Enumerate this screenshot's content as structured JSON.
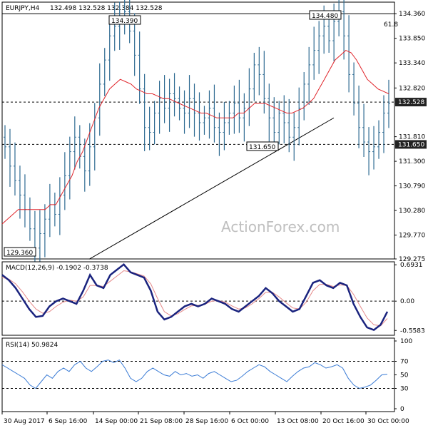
{
  "colors": {
    "price_bars": "#2f6b92",
    "ma_line": "#e0242a",
    "macd_line": "#1a237e",
    "signal_line": "#e58a8a",
    "rsi_line": "#3a7bd5",
    "hline": "#000000",
    "frame": "#000000"
  },
  "watermark": "ActionForex.com",
  "chart_data": [
    {
      "type": "ohlc",
      "title": "EURJPY,H4",
      "ohlc_header": "132.498 132.528 132.384 132.528",
      "ylim": [
        129.275,
        134.6
      ],
      "y_ticks": [
        "134.360",
        "133.850",
        "133.340",
        "132.820",
        "132.528",
        "131.810",
        "131.650",
        "131.300",
        "130.790",
        "130.280",
        "129.770",
        "129.275"
      ],
      "x_ticks": [
        "30 Aug 2017",
        "6 Sep 16:00",
        "14 Sep 00:00",
        "21 Sep 08:00",
        "28 Sep 16:00",
        "6 Oct 00:00",
        "13 Oct 08:00",
        "20 Oct 16:00",
        "30 Oct 00:00"
      ],
      "current_price": "132.528",
      "annotations": [
        {
          "label": "134.390",
          "value": 134.39
        },
        {
          "label": "134.480",
          "value": 134.48
        },
        {
          "label": "131.650",
          "value": 131.65
        },
        {
          "label": "129.360",
          "value": 129.36
        },
        {
          "label": "61.8",
          "value": 134.36
        }
      ],
      "horizontal_levels": [
        134.36,
        132.528,
        131.65
      ],
      "trendline": {
        "from": {
          "x": "6 Sep 16:00",
          "y": 129.2
        },
        "to": {
          "x": "20 Oct 16:00",
          "y": 132.2
        }
      },
      "series": [
        {
          "name": "close",
          "values": [
            131.6,
            131.2,
            130.9,
            130.6,
            130.3,
            129.9,
            129.5,
            129.8,
            130.1,
            130.4,
            130.2,
            130.6,
            131.0,
            131.5,
            131.8,
            131.4,
            131.1,
            131.6,
            132.2,
            132.9,
            133.4,
            133.9,
            134.1,
            134.3,
            134.4,
            134.0,
            133.5,
            132.8,
            132.0,
            131.9,
            132.3,
            132.6,
            132.4,
            132.7,
            132.6,
            132.4,
            132.3,
            132.6,
            132.3,
            132.1,
            132.2,
            132.4,
            132.0,
            131.9,
            132.1,
            132.3,
            132.5,
            132.2,
            132.4,
            132.8,
            133.3,
            133.1,
            132.6,
            132.2,
            131.9,
            132.3,
            132.1,
            131.8,
            132.0,
            132.4,
            132.9,
            133.3,
            133.6,
            133.9,
            134.1,
            133.8,
            134.2,
            134.4,
            133.9,
            133.1,
            132.5,
            132.0,
            131.7,
            131.5,
            131.6,
            131.9,
            132.3,
            132.5
          ]
        },
        {
          "name": "ma",
          "values": [
            130.0,
            130.1,
            130.2,
            130.3,
            130.3,
            130.3,
            130.3,
            130.3,
            130.3,
            130.4,
            130.4,
            130.6,
            130.8,
            131.0,
            131.3,
            131.5,
            131.8,
            132.1,
            132.4,
            132.6,
            132.8,
            132.9,
            133.0,
            132.95,
            132.9,
            132.8,
            132.75,
            132.7,
            132.7,
            132.65,
            132.6,
            132.6,
            132.55,
            132.5,
            132.45,
            132.4,
            132.35,
            132.3,
            132.3,
            132.25,
            132.2,
            132.2,
            132.2,
            132.2,
            132.3,
            132.3,
            132.4,
            132.5,
            132.5,
            132.5,
            132.45,
            132.4,
            132.35,
            132.3,
            132.3,
            132.35,
            132.4,
            132.5,
            132.6,
            132.8,
            133.0,
            133.2,
            133.4,
            133.5,
            133.6,
            133.55,
            133.4,
            133.2,
            133.0,
            132.9,
            132.8,
            132.75,
            132.7
          ]
        }
      ]
    },
    {
      "type": "line",
      "title": "MACD(12,26,9) -0.1902 -0.3738",
      "ylim": [
        -0.65,
        0.75
      ],
      "y_ticks": [
        "0.6931",
        "0.00",
        "-0.5583"
      ],
      "series": [
        {
          "name": "macd",
          "values": [
            0.5,
            0.4,
            0.25,
            0.05,
            -0.15,
            -0.3,
            -0.28,
            -0.1,
            0.0,
            0.05,
            0.0,
            -0.05,
            0.2,
            0.5,
            0.3,
            0.25,
            0.5,
            0.6,
            0.7,
            0.55,
            0.5,
            0.45,
            0.2,
            -0.2,
            -0.35,
            -0.3,
            -0.2,
            -0.1,
            -0.05,
            -0.1,
            -0.05,
            0.05,
            0.0,
            -0.05,
            -0.15,
            -0.2,
            -0.1,
            0.0,
            0.1,
            0.25,
            0.15,
            0.0,
            -0.1,
            -0.2,
            -0.15,
            0.1,
            0.35,
            0.4,
            0.3,
            0.25,
            0.35,
            0.3,
            -0.05,
            -0.3,
            -0.5,
            -0.55,
            -0.45,
            -0.2
          ]
        },
        {
          "name": "signal",
          "values": [
            0.45,
            0.42,
            0.33,
            0.18,
            0.0,
            -0.15,
            -0.23,
            -0.2,
            -0.1,
            -0.02,
            0.02,
            0.0,
            0.08,
            0.3,
            0.3,
            0.28,
            0.38,
            0.48,
            0.58,
            0.56,
            0.52,
            0.48,
            0.33,
            0.05,
            -0.2,
            -0.28,
            -0.24,
            -0.16,
            -0.09,
            -0.08,
            -0.06,
            0.0,
            0.01,
            -0.02,
            -0.09,
            -0.15,
            -0.13,
            -0.05,
            0.05,
            0.17,
            0.17,
            0.08,
            -0.03,
            -0.13,
            -0.15,
            -0.02,
            0.2,
            0.32,
            0.32,
            0.28,
            0.31,
            0.3,
            0.13,
            -0.1,
            -0.32,
            -0.45,
            -0.47,
            -0.33
          ]
        }
      ]
    },
    {
      "type": "line",
      "title": "RSI(14) 50.9824",
      "ylim": [
        0,
        100
      ],
      "y_ticks": [
        "100",
        "70",
        "50",
        "30",
        "0"
      ],
      "levels": [
        70,
        30
      ],
      "series": [
        {
          "name": "rsi",
          "values": [
            65,
            60,
            55,
            50,
            45,
            35,
            30,
            40,
            50,
            45,
            55,
            60,
            55,
            65,
            70,
            60,
            55,
            62,
            70,
            72,
            68,
            72,
            60,
            45,
            40,
            45,
            55,
            60,
            55,
            50,
            48,
            55,
            50,
            52,
            48,
            50,
            45,
            52,
            55,
            50,
            45,
            40,
            42,
            48,
            55,
            60,
            65,
            62,
            55,
            50,
            45,
            40,
            48,
            55,
            60,
            62,
            68,
            65,
            60,
            62,
            65,
            60,
            45,
            35,
            30,
            32,
            35,
            42,
            50,
            51
          ]
        }
      ]
    }
  ]
}
